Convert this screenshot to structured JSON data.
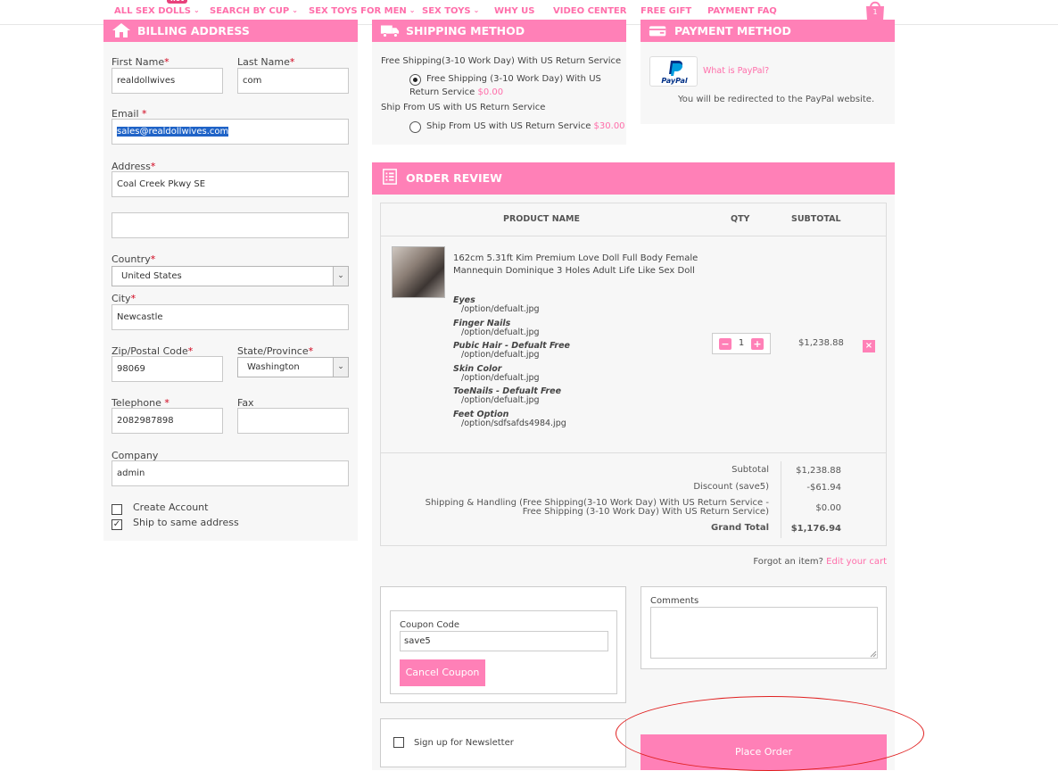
{
  "nav": {
    "items": [
      {
        "label": "ALL SEX DOLLS",
        "chevron": true
      },
      {
        "label": "SEARCH BY CUP",
        "chevron": true
      },
      {
        "label": "SEX TOYS FOR MEN",
        "chevron": true
      },
      {
        "label": "SEX TOYS",
        "chevron": true
      },
      {
        "label": "WHY US",
        "chevron": false
      },
      {
        "label": "VIDEO CENTER",
        "chevron": false
      },
      {
        "label": "FREE GIFT",
        "chevron": false
      },
      {
        "label": "PAYMENT FAQ",
        "chevron": false
      }
    ],
    "hot_badge": "hot",
    "cart_count": "1"
  },
  "billing": {
    "title": "BILLING ADDRESS",
    "first_name_label": "First Name",
    "first_name": "realdollwives",
    "last_name_label": "Last Name",
    "last_name": "com",
    "email_label": "Email",
    "email": "sales@realdollwives.com",
    "address_label": "Address",
    "address1": "Coal Creek Pkwy SE",
    "address2": "",
    "country_label": "Country",
    "country": "United States",
    "city_label": "City",
    "city": "Newcastle",
    "zip_label": "Zip/Postal Code",
    "zip": "98069",
    "state_label": "State/Province",
    "state": "Washington",
    "telephone_label": "Telephone",
    "telephone": "2082987898",
    "fax_label": "Fax",
    "fax": "",
    "company_label": "Company",
    "company": "admin",
    "create_account_label": "Create Account",
    "create_account_checked": false,
    "ship_same_label": "Ship to same address",
    "ship_same_checked": true,
    "required_mark": "*"
  },
  "shipping": {
    "title": "SHIPPING METHOD",
    "group1": "Free Shipping(3-10 Work Day) With US Return Service",
    "option1_text": "Free Shipping (3-10 Work Day) With US Return Service",
    "option1_price": "$0.00",
    "option1_selected": true,
    "group2": "Ship From US with US Return Service",
    "option2_text": "Ship From US with US Return Service",
    "option2_price": "$30.00",
    "option2_selected": false
  },
  "payment": {
    "title": "PAYMENT METHOD",
    "paypal_logo_text": "PayPal",
    "what_is_paypal": "What is PayPal?",
    "redirect_note": "You will be redirected to the PayPal website."
  },
  "review": {
    "title": "ORDER REVIEW",
    "col_product": "PRODUCT NAME",
    "col_qty": "QTY",
    "col_subtotal": "SUBTOTAL",
    "product_name": "162cm 5.31ft Kim Premium Love Doll Full Body Female Mannequin Dominique 3 Holes Adult Life Like Sex Doll",
    "options": [
      {
        "name": "Eyes",
        "value": "/option/defualt.jpg"
      },
      {
        "name": "Finger Nails",
        "value": "/option/defualt.jpg"
      },
      {
        "name": "Pubic Hair - Defualt Free",
        "value": "/option/defualt.jpg"
      },
      {
        "name": "Skin Color",
        "value": "/option/defualt.jpg"
      },
      {
        "name": "ToeNails - Defualt Free",
        "value": "/option/defualt.jpg"
      },
      {
        "name": "Feet Option",
        "value": "/option/sdfsafds4984.jpg"
      }
    ],
    "qty": "1",
    "line_subtotal": "$1,238.88",
    "subtotal_label": "Subtotal",
    "subtotal": "$1,238.88",
    "discount_label": "Discount (save5)",
    "discount": "-$61.94",
    "shipping_label": "Shipping & Handling (Free Shipping(3-10 Work Day) With US Return Service - Free Shipping (3-10 Work Day) With US Return Service)",
    "shipping_value": "$0.00",
    "grand_total_label": "Grand Total",
    "grand_total": "$1,176.94",
    "forgot_text": "Forgot an item?",
    "edit_cart": "Edit your cart"
  },
  "coupon": {
    "label": "Coupon Code",
    "value": "save5",
    "cancel_label": "Cancel Coupon"
  },
  "comments": {
    "label": "Comments",
    "value": ""
  },
  "newsletter": {
    "label": "Sign up for Newsletter",
    "checked": false
  },
  "place_order_label": "Place Order",
  "colors": {
    "accent": "#ff80b7",
    "link": "#ff6eaa",
    "annotation": "#e02020"
  }
}
